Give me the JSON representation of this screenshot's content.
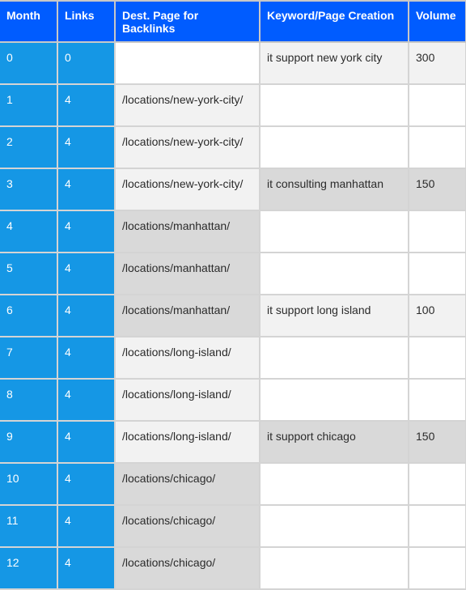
{
  "table": {
    "headers": [
      "Month",
      "Links",
      "Dest. Page for Backlinks",
      "Keyword/Page Creation",
      "Volume"
    ],
    "rows": [
      {
        "month": "0",
        "links": "0",
        "dest": "",
        "keyword": "it support new york city",
        "volume": "300",
        "dest_shade": "white",
        "kw_shade": "light"
      },
      {
        "month": "1",
        "links": "4",
        "dest": "/locations/new-york-city/",
        "keyword": "",
        "volume": "",
        "dest_shade": "light",
        "kw_shade": "white"
      },
      {
        "month": "2",
        "links": "4",
        "dest": "/locations/new-york-city/",
        "keyword": "",
        "volume": "",
        "dest_shade": "light",
        "kw_shade": "white"
      },
      {
        "month": "3",
        "links": "4",
        "dest": "/locations/new-york-city/",
        "keyword": "it consulting manhattan",
        "volume": "150",
        "dest_shade": "light",
        "kw_shade": "dark"
      },
      {
        "month": "4",
        "links": "4",
        "dest": "/locations/manhattan/",
        "keyword": "",
        "volume": "",
        "dest_shade": "dark",
        "kw_shade": "white"
      },
      {
        "month": "5",
        "links": "4",
        "dest": "/locations/manhattan/",
        "keyword": "",
        "volume": "",
        "dest_shade": "dark",
        "kw_shade": "white"
      },
      {
        "month": "6",
        "links": "4",
        "dest": "/locations/manhattan/",
        "keyword": "it support long island",
        "volume": "100",
        "dest_shade": "dark",
        "kw_shade": "light"
      },
      {
        "month": "7",
        "links": "4",
        "dest": "/locations/long-island/",
        "keyword": "",
        "volume": "",
        "dest_shade": "light",
        "kw_shade": "white"
      },
      {
        "month": "8",
        "links": "4",
        "dest": "/locations/long-island/",
        "keyword": "",
        "volume": "",
        "dest_shade": "light",
        "kw_shade": "white"
      },
      {
        "month": "9",
        "links": "4",
        "dest": "/locations/long-island/",
        "keyword": "it support chicago",
        "volume": "150",
        "dest_shade": "light",
        "kw_shade": "dark"
      },
      {
        "month": "10",
        "links": "4",
        "dest": "/locations/chicago/",
        "keyword": "",
        "volume": "",
        "dest_shade": "dark",
        "kw_shade": "white"
      },
      {
        "month": "11",
        "links": "4",
        "dest": "/locations/chicago/",
        "keyword": "",
        "volume": "",
        "dest_shade": "dark",
        "kw_shade": "white"
      },
      {
        "month": "12",
        "links": "4",
        "dest": "/locations/chicago/",
        "keyword": "",
        "volume": "",
        "dest_shade": "dark",
        "kw_shade": "white"
      }
    ]
  },
  "colors": {
    "header_bg": "#005cff",
    "index_col_bg": "#1597e5",
    "shade_light": "#f2f2f2",
    "shade_dark": "#d9d9d9"
  }
}
